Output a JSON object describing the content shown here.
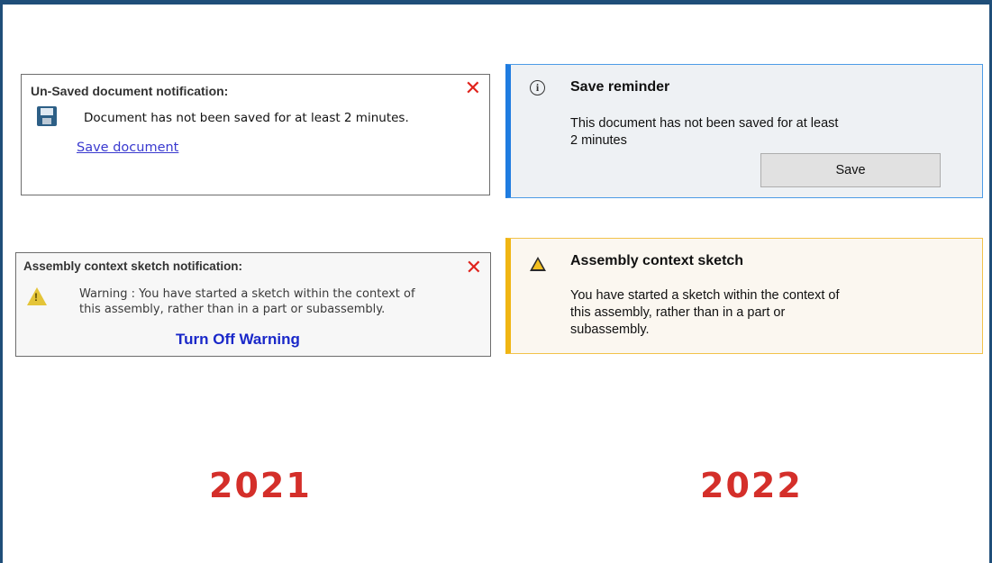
{
  "old": {
    "save_notification": {
      "title": "Un-Saved document notification:",
      "close_glyph": "✕",
      "message": "Document has not been saved for at least 2 minutes.",
      "link": "Save document",
      "icon": "floppy-disk-icon"
    },
    "assembly_notification": {
      "title": "Assembly context sketch notification:",
      "close_glyph": "✕",
      "message_line1": "Warning : You have started a sketch within the context of",
      "message_line2": "this assembly, rather than in a part or subassembly.",
      "link": "Turn Off Warning",
      "icon": "warning-icon"
    },
    "year": "2021"
  },
  "new": {
    "save_reminder": {
      "title": "Save reminder",
      "message_line1": "This document has not been saved for at least",
      "message_line2": "2 minutes",
      "button": "Save",
      "icon": "info-icon",
      "accent": "#1f7ce0"
    },
    "assembly_sketch": {
      "title": "Assembly context sketch",
      "message_line1": "You have started a sketch within the context of",
      "message_line2": "this assembly, rather than in a part or",
      "message_line3": "subassembly.",
      "icon": "warning-icon",
      "accent": "#f0b513"
    },
    "year": "2022"
  },
  "colors": {
    "frame": "#1f4e79",
    "year_text": "#d42f2a",
    "close_x": "#e0231c",
    "link_blue": "#1a28c9"
  }
}
